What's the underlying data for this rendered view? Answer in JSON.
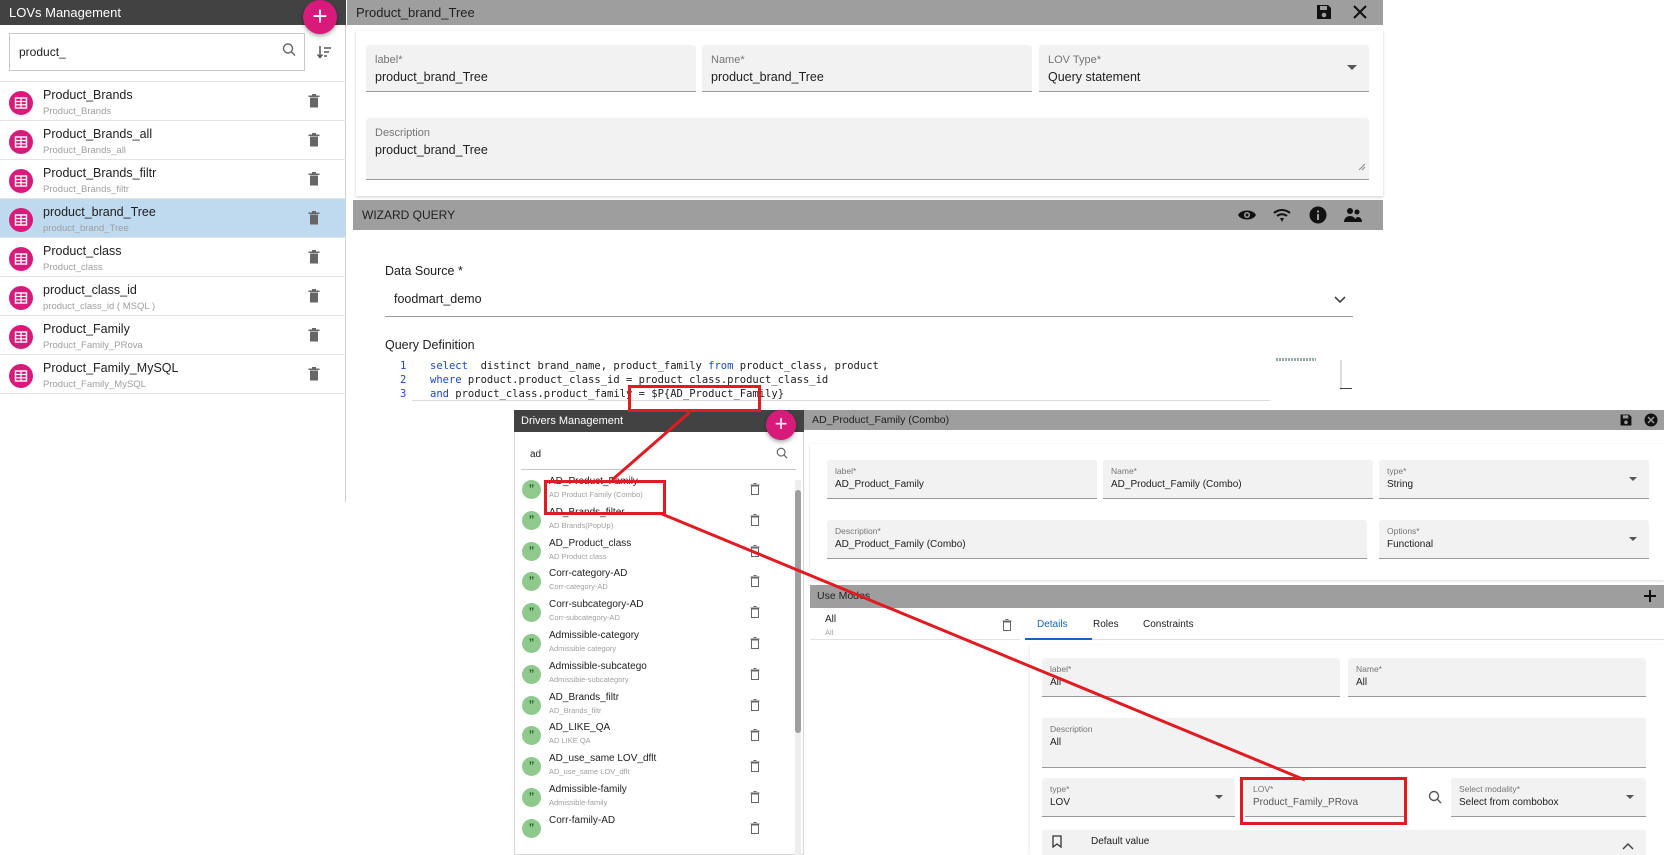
{
  "lov_panel": {
    "title": "LOVs Management",
    "add_label": "+",
    "search_value": "product_",
    "items": [
      {
        "title": "Product_Brands",
        "subtitle": "Product_Brands"
      },
      {
        "title": "Product_Brands_all",
        "subtitle": "Product_Brands_all"
      },
      {
        "title": "Product_Brands_filtr",
        "subtitle": "Product_Brands_filtr"
      },
      {
        "title": "product_brand_Tree",
        "subtitle": "product_brand_Tree"
      },
      {
        "title": "Product_class",
        "subtitle": "Product_class"
      },
      {
        "title": "product_class_id",
        "subtitle": "product_class_id ( MSQL )"
      },
      {
        "title": "Product_Family",
        "subtitle": "Product_Family_PRova"
      },
      {
        "title": "Product_Family_MySQL",
        "subtitle": "Product_Family_MySQL"
      }
    ]
  },
  "detail": {
    "title": "Product_brand_Tree",
    "label_label": "label*",
    "label_value": "product_brand_Tree",
    "name_label": "Name*",
    "name_value": "product_brand_Tree",
    "lovtype_label": "LOV Type*",
    "lovtype_value": "Query statement",
    "description_label": "Description",
    "description_value": "product_brand_Tree",
    "wizard_title": "WIZARD QUERY",
    "datasource_label": "Data Source *",
    "datasource_value": "foodmart_demo",
    "query_label": "Query Definition",
    "code_lines": [
      {
        "num": "1",
        "kw": "select",
        "rest": "  distinct brand_name, product_family ",
        "kw2": "from",
        "rest2": " product_class, product"
      },
      {
        "num": "2",
        "kw": "where",
        "rest": " product.product_class_id = product_class.product_class_id",
        "kw2": "",
        "rest2": ""
      },
      {
        "num": "3",
        "kw": "and",
        "rest": " product_class.product_family = ",
        "kw2": "",
        "rest2": "$P{AD_Product_Family}"
      }
    ]
  },
  "drivers": {
    "title": "Drivers Management",
    "add_label": "+",
    "search_value": "ad",
    "items": [
      {
        "title": "AD_Product_Family",
        "subtitle": "AD Product Family (Combo)"
      },
      {
        "title": "AD_Brands_filter",
        "subtitle": "AD Brands(PopUp)"
      },
      {
        "title": "AD_Product_class",
        "subtitle": "AD Product class"
      },
      {
        "title": "Corr-category-AD",
        "subtitle": "Corr-category-AD"
      },
      {
        "title": "Corr-subcategory-AD",
        "subtitle": "Corr-subcategory-AD"
      },
      {
        "title": "Admissible-category",
        "subtitle": "Admissible category"
      },
      {
        "title": "Admissible-subcatego",
        "subtitle": "Admissible-subcategory"
      },
      {
        "title": "AD_Brands_filtr",
        "subtitle": "AD_Brands_filtr"
      },
      {
        "title": "AD_LIKE_QA",
        "subtitle": "AD LIKE QA"
      },
      {
        "title": "AD_use_same LOV_dflt",
        "subtitle": "AD_use_same LOV_dflt"
      },
      {
        "title": "Admissible-family",
        "subtitle": "Admissible-family"
      },
      {
        "title": "Corr-family-AD",
        "subtitle": ""
      }
    ]
  },
  "driver_detail": {
    "title": "AD_Product_Family (Combo)",
    "label_label": "label*",
    "label_value": "AD_Product_Family",
    "name_label": "Name*",
    "name_value": "AD_Product_Family (Combo)",
    "type_label": "type*",
    "type_value": "String",
    "description_label": "Description*",
    "description_value": "AD_Product_Family (Combo)",
    "options_label": "Options*",
    "options_value": "Functional",
    "use_modes_title": "Use Modes",
    "use_mode_name": "All",
    "use_mode_sub": "All",
    "tabs": [
      "Details",
      "Roles",
      "Constraints"
    ],
    "um_label_label": "label*",
    "um_label_value": "All",
    "um_name_label": "Name*",
    "um_name_value": "All",
    "um_desc_label": "Description",
    "um_desc_value": "All",
    "um_type_label": "type*",
    "um_type_value": "LOV",
    "um_lov_label": "LOV*",
    "um_lov_value": "Product_Family_PRova",
    "um_modality_label": "Select modality*",
    "um_modality_value": "Select from combobox",
    "default_value_label": "Default value"
  },
  "colors": {
    "accent": "#d81b7a",
    "highlight": "#e11b22",
    "selected_row": "#bfd9ef"
  }
}
